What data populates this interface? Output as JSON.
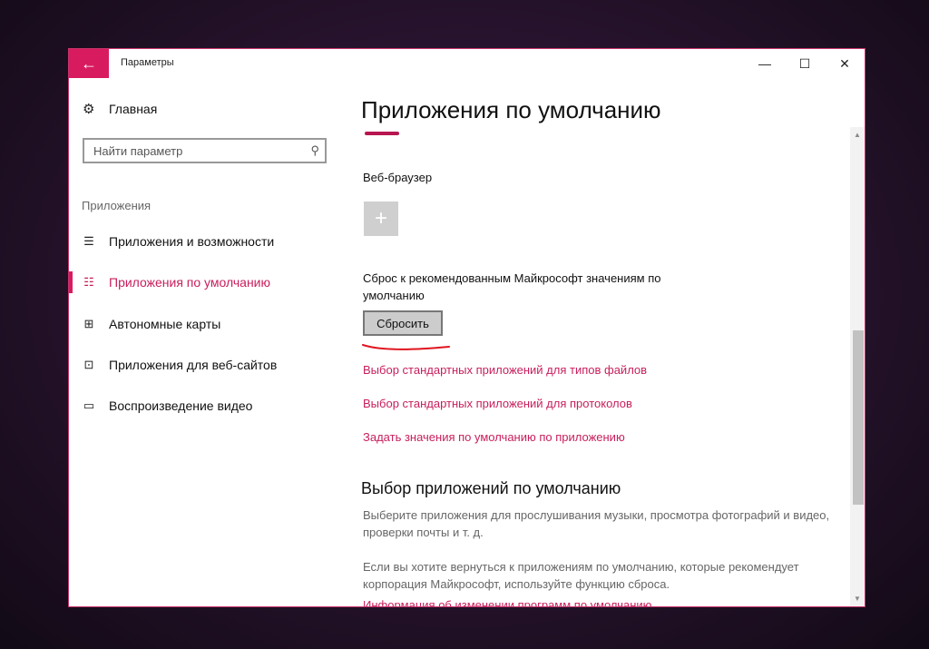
{
  "window": {
    "title": "Параметры",
    "back_icon": "←",
    "minimize_icon": "—",
    "maximize_icon": "☐",
    "close_icon": "✕"
  },
  "sidebar": {
    "home": {
      "label": "Главная",
      "icon": "⚙"
    },
    "search": {
      "placeholder": "Найти параметр",
      "icon": "⚲"
    },
    "section_heading": "Приложения",
    "items": [
      {
        "label": "Приложения и возможности",
        "icon": "☰",
        "active": false
      },
      {
        "label": "Приложения по умолчанию",
        "icon": "☷",
        "active": true
      },
      {
        "label": "Автономные карты",
        "icon": "⊞",
        "active": false
      },
      {
        "label": "Приложения для веб-сайтов",
        "icon": "⊡",
        "active": false
      },
      {
        "label": "Воспроизведение видео",
        "icon": "▭",
        "active": false
      }
    ]
  },
  "content": {
    "title": "Приложения по умолчанию",
    "web_browser_label": "Веб-браузер",
    "plus_icon": "+",
    "reset_description": "Сброс к рекомендованным Майкрософт значениям по умолчанию",
    "reset_button": "Сбросить",
    "links": [
      "Выбор стандартных приложений для типов файлов",
      "Выбор стандартных приложений для протоколов",
      "Задать значения по умолчанию по приложению"
    ],
    "section2_title": "Выбор приложений по умолчанию",
    "section2_desc": "Выберите приложения для прослушивания музыки, просмотра фотографий и видео, проверки почты и т. д.",
    "section2_note": "Если вы хотите вернуться к приложениям по умолчанию, которые рекомендует корпорация Майкрософт, используйте функцию сброса.",
    "section2_link": "Информация об изменении программ по умолчанию"
  },
  "colors": {
    "accent": "#d81b5f",
    "link": "#c81e5c",
    "annotation_red": "#e0141e"
  }
}
